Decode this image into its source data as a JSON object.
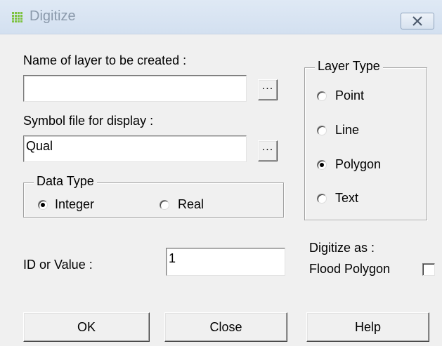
{
  "window": {
    "title": "Digitize",
    "app_icon": "grid-icon",
    "close_icon": "close-icon"
  },
  "layer_name": {
    "label": "Name of layer to be created :",
    "value": "",
    "browse_label": "..."
  },
  "symbol_file": {
    "label": "Symbol file for display :",
    "value": "Qual",
    "browse_label": "..."
  },
  "data_type": {
    "legend": "Data Type",
    "options": [
      {
        "label": "Integer",
        "checked": true
      },
      {
        "label": "Real",
        "checked": false
      }
    ]
  },
  "layer_type": {
    "legend": "Layer Type",
    "options": [
      {
        "label": "Point",
        "checked": false
      },
      {
        "label": "Line",
        "checked": false
      },
      {
        "label": "Polygon",
        "checked": true
      },
      {
        "label": "Text",
        "checked": false
      }
    ]
  },
  "id_value": {
    "label": "ID or Value :",
    "value": "1"
  },
  "digitize_as": {
    "label": "Digitize as :",
    "option_label": "Flood Polygon",
    "checked": false
  },
  "buttons": {
    "ok": "OK",
    "close": "Close",
    "help": "Help"
  },
  "colors": {
    "dialog_bg": "#f0f0f0",
    "titlebar_bg": "#d6e2f0",
    "title_text": "#8a99ab",
    "app_icon": "#7dc241"
  }
}
